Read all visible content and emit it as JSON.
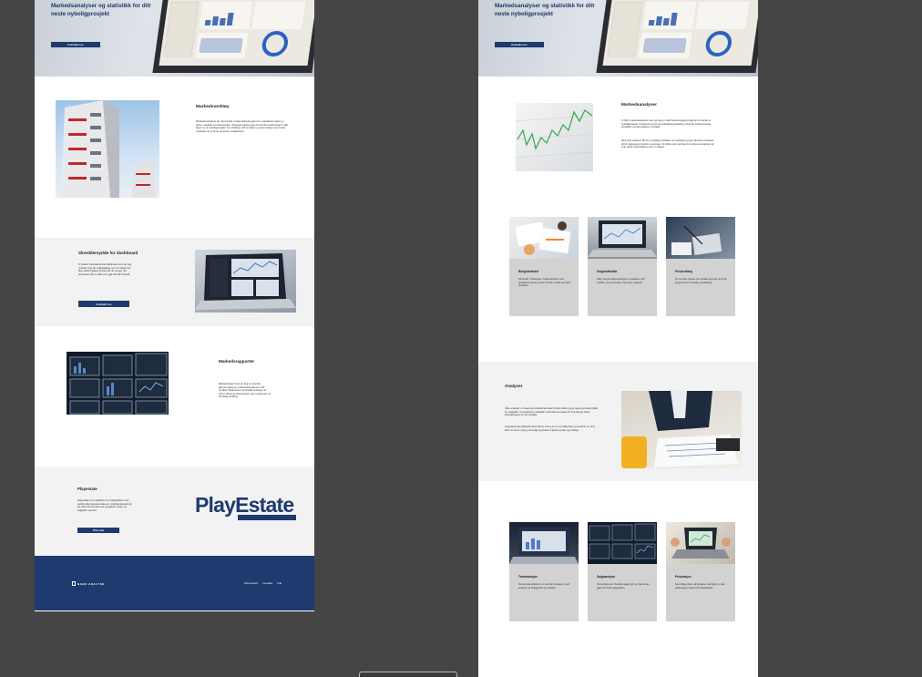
{
  "left_page": {
    "hero": {
      "title": "Markedsanalyser og statistikk for ditt neste nyboligprosjekt",
      "cta": "Kontakt oss"
    },
    "section1": {
      "title": "Markedsverktøy",
      "body": "Markedsverktøyet gir deg innsikt i boligmarkedet gjennom oppdaterte data om priser, salgstid og etterspørsel. Verktøyet hjelper deg å ta bedre beslutninger i alle faser av et nyboligprosjekt. Se utvikling i ditt område og sammenlign med andre markeder for å finne de beste mulighetene."
    },
    "section2": {
      "title": "Skreddersydde for dashboard",
      "body": "Vi utvikler skreddersydde dashboard som gir deg oversikt over de nøkkeltallene som er viktigst for deg. Enkelt tilgang til data når du trenger det, presentert på en måte som gjør det lett å forstå.",
      "cta": "Kontakt oss"
    },
    "section3": {
      "title": "Markedsrapporter",
      "body": "Markedsrapportene gir deg en grundig gjennomgang av markedssituasjonen i ditt område. Rapportene inneholder analyser av priser, tilbud og etterspørsel, samt prognoser for fremtidig utvikling."
    },
    "section4": {
      "title": "Playestate",
      "body": "Playestate er en plattform for boligutviklere som samler alle relevante data om nyboligmarkedet på ett sted. Få oversikt over prosjekter, priser og salgstall i sanntid.",
      "cta": "Prøv det",
      "logo_text": "PlayEstate"
    },
    "footer": {
      "brand": "NABO ANALYSE",
      "links": [
        "Personvern",
        "Cookies",
        "Info"
      ]
    }
  },
  "right_page": {
    "hero": {
      "title": "Markedsanalyser og statistikk for ditt neste nyboligprosjekt",
      "cta": "Kontakt oss"
    },
    "section1": {
      "title": "Markedsanalyser",
      "body1": "Vi tilbyr markedsanalyser som gir deg et solid beslutningsgrunnlag før du starter et nyboligprosjekt. Analysene tar for seg befolkningsutvikling, prisnivå, konkurrerende prosjekter og etterspørsel i området.",
      "body2": "Med våre analyser får du en tydelig forståelse av markedet og kan tilpasse prosjektet ditt til målgruppens behov og ønsker. Vi jobber tett med deg for å sikre at analysen gir svar på de spørsmålene som er viktigst."
    },
    "cards_row1": [
      {
        "title": "Boligmarkedet",
        "body": "Få innsikt i utviklingen i boligmarkedet med oppdaterte tall og trender fra ditt område og resten av landet."
      },
      {
        "title": "Salgsstatistikk",
        "body": "Følg med på salgsutviklingen i prosjekter i ditt område og sammenlign med egne salgstall."
      },
      {
        "title": "Prisutvikling",
        "body": "Se hvordan prisene har utviklet seg over tid og få prognoser for fremtidig prisutvikling."
      }
    ],
    "section2": {
      "title": "Analyser",
      "body1": "Våre analyser er basert på omfattende data fra flere kilder og gir deg et komplett bilde av markedet. Vi kombinerer statistikk med lokal kunnskap for å gi deg de beste anbefalingene for ditt prosjekt.",
      "body2": "Analysene kan tilpasses dine behov, enten du er i en tidlig fase og vurderer en tomt, eller om du er i gang med salg og ønsker å justere priser og strategi."
    },
    "cards_row2": [
      {
        "title": "Tomteanalyse",
        "body": "Vurder potensialet for en tomt før du kjøper, med analyser av beliggenhet og marked."
      },
      {
        "title": "Salgsanalyse",
        "body": "Få oversikt over hvordan salget går og hva du kan gjøre for å øke salgstakten."
      },
      {
        "title": "Prisanalyse",
        "body": "Sett riktige priser på boligene med hjelp av våre prisanalyser basert på markedsdata."
      }
    ]
  },
  "colors": {
    "navy": "#1f3a6e",
    "canvas": "#454545",
    "section_grey": "#f2f2f2",
    "card_grey": "#d2d2d2"
  }
}
